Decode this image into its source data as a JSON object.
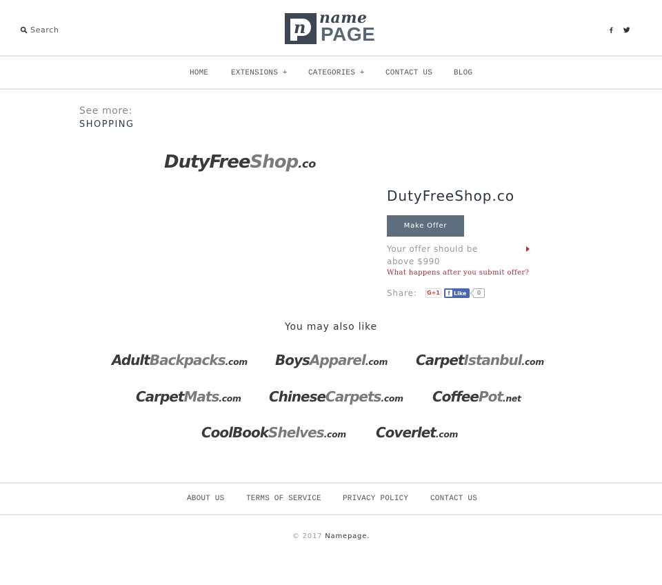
{
  "header": {
    "search_label": "Search",
    "search_icon": "search-icon",
    "logo": {
      "small_text": "name",
      "large_text": "PAGE",
      "mark_letter": "n"
    },
    "social": [
      {
        "name": "facebook-icon",
        "glyph": "f"
      },
      {
        "name": "twitter-icon",
        "glyph": "bird"
      }
    ]
  },
  "nav": {
    "items": [
      {
        "label": "HOME"
      },
      {
        "label": "EXTENSIONS +"
      },
      {
        "label": "CATEGORIES +"
      },
      {
        "label": "CONTACT US"
      },
      {
        "label": "BLOG"
      }
    ]
  },
  "see_more": {
    "label": "See more:",
    "category": "SHOPPING"
  },
  "domain": {
    "logo_parts": {
      "first": "Duty",
      "second": "FreeShop",
      "tld": ".co",
      "dark": "DutyFree",
      "light": "Shop"
    },
    "name": "DutyFreeShop.co",
    "make_offer_label": "Make Offer",
    "offer_note": "Your offer should be above $990",
    "min_offer": "$990",
    "what_happens_link": "What happens after you submit offer?",
    "share_label": "Share:",
    "gplus_label": "G+1",
    "fb_like_label": "Like",
    "fb_like_count": "0"
  },
  "also_like": {
    "title": "You may also like",
    "items": [
      {
        "dark": "Adult",
        "light": "Backpacks",
        "tld": ".com"
      },
      {
        "dark": "Boys",
        "light": "Apparel",
        "tld": ".com"
      },
      {
        "dark": "Carpet",
        "light": "Istanbul",
        "tld": ".com"
      },
      {
        "dark": "Carpet",
        "light": "Mats",
        "tld": ".com"
      },
      {
        "dark": "Chinese",
        "light": "Carpets",
        "tld": ".com"
      },
      {
        "dark": "Coffee",
        "light": "Pot",
        "tld": ".net"
      },
      {
        "dark": "CoolBook",
        "light": "Shelves",
        "tld": ".com"
      },
      {
        "dark": "Coverlet",
        "light": "",
        "tld": ".com"
      }
    ]
  },
  "footer": {
    "links": [
      {
        "label": "ABOUT US"
      },
      {
        "label": "TERMS OF SERVICE"
      },
      {
        "label": "PRIVACY POLICY"
      },
      {
        "label": "CONTACT US"
      }
    ],
    "copyright_prefix": "© 2017",
    "brand": "Namepage."
  },
  "colors": {
    "button_bg": "#5f6e7c",
    "link_red": "#a02a3a",
    "logo_dark": "#3e4654",
    "fb_blue": "#4a67ad"
  }
}
